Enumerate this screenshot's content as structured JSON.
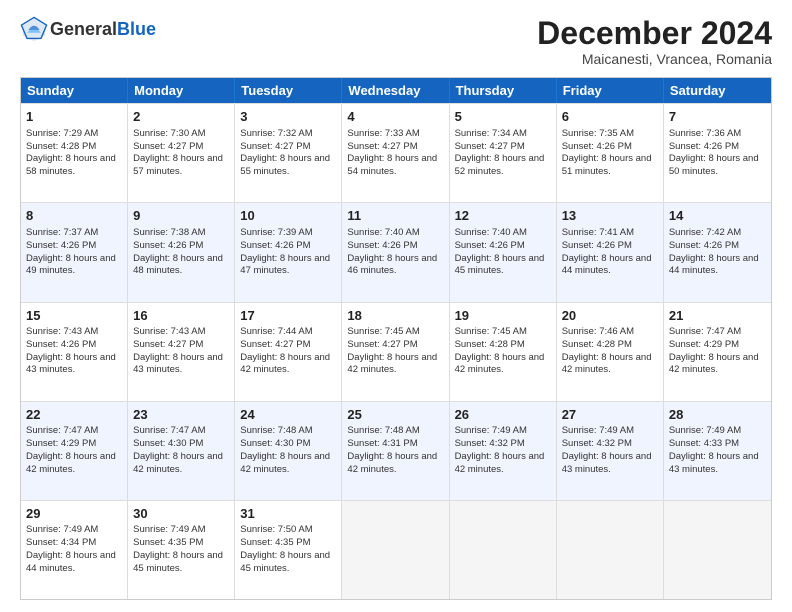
{
  "header": {
    "logo_line1": "General",
    "logo_line2": "Blue",
    "month_title": "December 2024",
    "location": "Maicanesti, Vrancea, Romania"
  },
  "days_of_week": [
    "Sunday",
    "Monday",
    "Tuesday",
    "Wednesday",
    "Thursday",
    "Friday",
    "Saturday"
  ],
  "weeks": [
    [
      {
        "day": "1",
        "sunrise": "7:29 AM",
        "sunset": "4:28 PM",
        "daylight": "8 hours and 58 minutes."
      },
      {
        "day": "2",
        "sunrise": "7:30 AM",
        "sunset": "4:27 PM",
        "daylight": "8 hours and 57 minutes."
      },
      {
        "day": "3",
        "sunrise": "7:32 AM",
        "sunset": "4:27 PM",
        "daylight": "8 hours and 55 minutes."
      },
      {
        "day": "4",
        "sunrise": "7:33 AM",
        "sunset": "4:27 PM",
        "daylight": "8 hours and 54 minutes."
      },
      {
        "day": "5",
        "sunrise": "7:34 AM",
        "sunset": "4:27 PM",
        "daylight": "8 hours and 52 minutes."
      },
      {
        "day": "6",
        "sunrise": "7:35 AM",
        "sunset": "4:26 PM",
        "daylight": "8 hours and 51 minutes."
      },
      {
        "day": "7",
        "sunrise": "7:36 AM",
        "sunset": "4:26 PM",
        "daylight": "8 hours and 50 minutes."
      }
    ],
    [
      {
        "day": "8",
        "sunrise": "7:37 AM",
        "sunset": "4:26 PM",
        "daylight": "8 hours and 49 minutes."
      },
      {
        "day": "9",
        "sunrise": "7:38 AM",
        "sunset": "4:26 PM",
        "daylight": "8 hours and 48 minutes."
      },
      {
        "day": "10",
        "sunrise": "7:39 AM",
        "sunset": "4:26 PM",
        "daylight": "8 hours and 47 minutes."
      },
      {
        "day": "11",
        "sunrise": "7:40 AM",
        "sunset": "4:26 PM",
        "daylight": "8 hours and 46 minutes."
      },
      {
        "day": "12",
        "sunrise": "7:40 AM",
        "sunset": "4:26 PM",
        "daylight": "8 hours and 45 minutes."
      },
      {
        "day": "13",
        "sunrise": "7:41 AM",
        "sunset": "4:26 PM",
        "daylight": "8 hours and 44 minutes."
      },
      {
        "day": "14",
        "sunrise": "7:42 AM",
        "sunset": "4:26 PM",
        "daylight": "8 hours and 44 minutes."
      }
    ],
    [
      {
        "day": "15",
        "sunrise": "7:43 AM",
        "sunset": "4:26 PM",
        "daylight": "8 hours and 43 minutes."
      },
      {
        "day": "16",
        "sunrise": "7:43 AM",
        "sunset": "4:27 PM",
        "daylight": "8 hours and 43 minutes."
      },
      {
        "day": "17",
        "sunrise": "7:44 AM",
        "sunset": "4:27 PM",
        "daylight": "8 hours and 42 minutes."
      },
      {
        "day": "18",
        "sunrise": "7:45 AM",
        "sunset": "4:27 PM",
        "daylight": "8 hours and 42 minutes."
      },
      {
        "day": "19",
        "sunrise": "7:45 AM",
        "sunset": "4:28 PM",
        "daylight": "8 hours and 42 minutes."
      },
      {
        "day": "20",
        "sunrise": "7:46 AM",
        "sunset": "4:28 PM",
        "daylight": "8 hours and 42 minutes."
      },
      {
        "day": "21",
        "sunrise": "7:47 AM",
        "sunset": "4:29 PM",
        "daylight": "8 hours and 42 minutes."
      }
    ],
    [
      {
        "day": "22",
        "sunrise": "7:47 AM",
        "sunset": "4:29 PM",
        "daylight": "8 hours and 42 minutes."
      },
      {
        "day": "23",
        "sunrise": "7:47 AM",
        "sunset": "4:30 PM",
        "daylight": "8 hours and 42 minutes."
      },
      {
        "day": "24",
        "sunrise": "7:48 AM",
        "sunset": "4:30 PM",
        "daylight": "8 hours and 42 minutes."
      },
      {
        "day": "25",
        "sunrise": "7:48 AM",
        "sunset": "4:31 PM",
        "daylight": "8 hours and 42 minutes."
      },
      {
        "day": "26",
        "sunrise": "7:49 AM",
        "sunset": "4:32 PM",
        "daylight": "8 hours and 42 minutes."
      },
      {
        "day": "27",
        "sunrise": "7:49 AM",
        "sunset": "4:32 PM",
        "daylight": "8 hours and 43 minutes."
      },
      {
        "day": "28",
        "sunrise": "7:49 AM",
        "sunset": "4:33 PM",
        "daylight": "8 hours and 43 minutes."
      }
    ],
    [
      {
        "day": "29",
        "sunrise": "7:49 AM",
        "sunset": "4:34 PM",
        "daylight": "8 hours and 44 minutes."
      },
      {
        "day": "30",
        "sunrise": "7:49 AM",
        "sunset": "4:35 PM",
        "daylight": "8 hours and 45 minutes."
      },
      {
        "day": "31",
        "sunrise": "7:50 AM",
        "sunset": "4:35 PM",
        "daylight": "8 hours and 45 minutes."
      },
      {
        "day": "",
        "sunrise": "",
        "sunset": "",
        "daylight": ""
      },
      {
        "day": "",
        "sunrise": "",
        "sunset": "",
        "daylight": ""
      },
      {
        "day": "",
        "sunrise": "",
        "sunset": "",
        "daylight": ""
      },
      {
        "day": "",
        "sunrise": "",
        "sunset": "",
        "daylight": ""
      }
    ]
  ],
  "labels": {
    "sunrise": "Sunrise:",
    "sunset": "Sunset:",
    "daylight": "Daylight:"
  }
}
